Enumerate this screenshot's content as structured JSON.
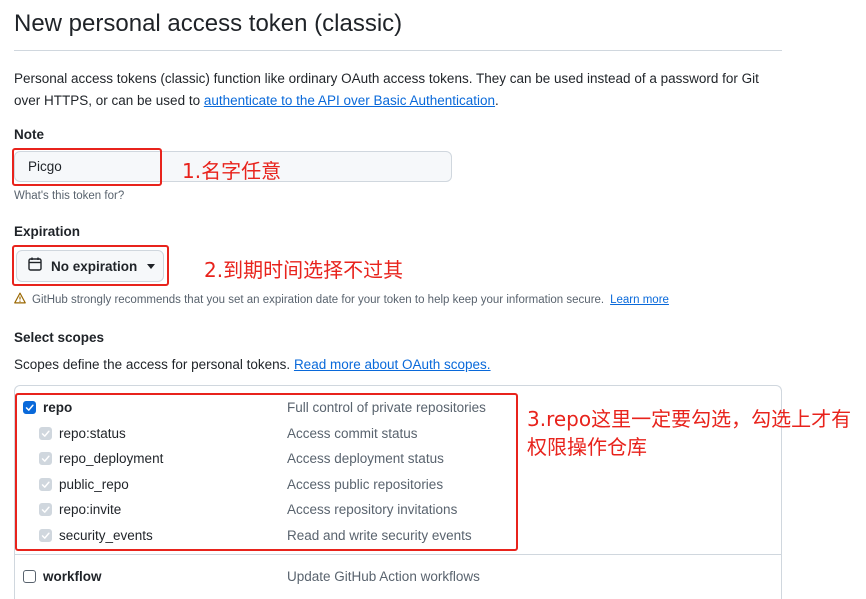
{
  "page": {
    "title": "New personal access token (classic)",
    "description_text": "Personal access tokens (classic) function like ordinary OAuth access tokens. They can be used instead of a password for Git over HTTPS, or can be used to ",
    "description_link": "authenticate to the API over Basic Authentication",
    "description_end": "."
  },
  "note": {
    "label": "Note",
    "value": "Picgo",
    "hint": "What's this token for?"
  },
  "expiration": {
    "label": "Expiration",
    "selected": "No expiration",
    "warning": "GitHub strongly recommends that you set an expiration date for your token to help keep your information secure.",
    "warning_link": "Learn more"
  },
  "scopes": {
    "label": "Select scopes",
    "description": "Scopes define the access for personal tokens.",
    "description_link": "Read more about OAuth scopes.",
    "items": [
      {
        "name": "repo",
        "description": "Full control of private repositories",
        "checked": true,
        "child": false
      },
      {
        "name": "repo:status",
        "description": "Access commit status",
        "checked": true,
        "child": true
      },
      {
        "name": "repo_deployment",
        "description": "Access deployment status",
        "checked": true,
        "child": true
      },
      {
        "name": "public_repo",
        "description": "Access public repositories",
        "checked": true,
        "child": true
      },
      {
        "name": "repo:invite",
        "description": "Access repository invitations",
        "checked": true,
        "child": true
      },
      {
        "name": "security_events",
        "description": "Read and write security events",
        "checked": true,
        "child": true
      },
      {
        "name": "workflow",
        "description": "Update GitHub Action workflows",
        "checked": false,
        "child": false
      }
    ]
  },
  "annotations": {
    "note": "1.名字任意",
    "expiration": "2.到期时间选择不过其",
    "repo_line1": "3.repo这里一定要勾选，勾选上才有",
    "repo_line2": "权限操作仓库"
  },
  "colors": {
    "annotation_red": "#e8231c",
    "link_blue": "#0969da",
    "checkbox_blue": "#0969da"
  }
}
